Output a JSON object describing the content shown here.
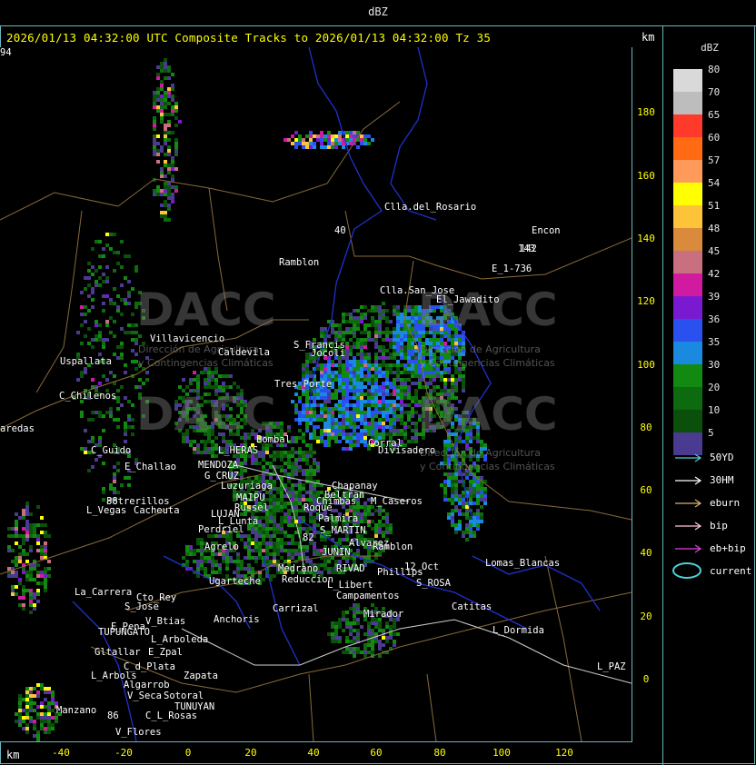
{
  "header": {
    "unit_label": "dBZ"
  },
  "title": "2026/01/13 04:32:00 UTC Composite Tracks to 2026/01/13 04:32:00 Tz 35",
  "km_top": "km",
  "km_bottom": "km",
  "legend": {
    "title": "dBZ",
    "scale": [
      {
        "value": "80",
        "color": "#d9d9d9"
      },
      {
        "value": "70",
        "color": "#bdbdbd"
      },
      {
        "value": "65",
        "color": "#ff3a2a"
      },
      {
        "value": "60",
        "color": "#ff6a12"
      },
      {
        "value": "57",
        "color": "#ff9a5a"
      },
      {
        "value": "54",
        "color": "#ffff00"
      },
      {
        "value": "51",
        "color": "#fdc43a"
      },
      {
        "value": "48",
        "color": "#d98a3a"
      },
      {
        "value": "45",
        "color": "#c87080"
      },
      {
        "value": "42",
        "color": "#d01aa0"
      },
      {
        "value": "39",
        "color": "#7a1ad0"
      },
      {
        "value": "36",
        "color": "#2a50f0"
      },
      {
        "value": "35",
        "color": "#1a8ae0"
      },
      {
        "value": "30",
        "color": "#128a12"
      },
      {
        "value": "20",
        "color": "#0e6a0e"
      },
      {
        "value": "10",
        "color": "#0a500a"
      },
      {
        "value": "5",
        "color": "#4a3a90"
      }
    ],
    "tracks": [
      {
        "label": "50YD",
        "color": "#4fd0d8"
      },
      {
        "label": "30HM",
        "color": "#ffffff"
      },
      {
        "label": "eburn",
        "color": "#e0b070"
      },
      {
        "label": "bip",
        "color": "#ffc8d8"
      },
      {
        "label": "eb+bip",
        "color": "#e040e0"
      }
    ],
    "current_label": "current",
    "current_color": "#4fd0d8"
  },
  "axes": {
    "y_ticks": [
      "180",
      "160",
      "140",
      "120",
      "100",
      "80",
      "60",
      "40",
      "20",
      "0"
    ],
    "x_ticks": [
      "-40",
      "-20",
      "0",
      "20",
      "40",
      "60",
      "80",
      "100",
      "120"
    ]
  },
  "places": [
    {
      "name": "Clla.del_Rosario"
    },
    {
      "name": "Encon"
    },
    {
      "name": "142"
    },
    {
      "name": "E_1-736"
    },
    {
      "name": "Ramblon"
    },
    {
      "name": "Clla.San_Jose"
    },
    {
      "name": "El_Jawadito"
    },
    {
      "name": "Villavicencio"
    },
    {
      "name": "Uspallata"
    },
    {
      "name": "Caldevila"
    },
    {
      "name": "S_Francis"
    },
    {
      "name": "Jocoli"
    },
    {
      "name": "Tres_Porte"
    },
    {
      "name": "C_Chilenos"
    },
    {
      "name": "aredas"
    },
    {
      "name": "Bombal"
    },
    {
      "name": "L_HERAS"
    },
    {
      "name": "Corral"
    },
    {
      "name": "Divisadero"
    },
    {
      "name": "C_Guido"
    },
    {
      "name": "E_Challao"
    },
    {
      "name": "MENDOZA"
    },
    {
      "name": "G_CRUZ"
    },
    {
      "name": "Luzuriaga"
    },
    {
      "name": "Chapanay"
    },
    {
      "name": "Beltran"
    },
    {
      "name": "Chimbas"
    },
    {
      "name": "M_Caseros"
    },
    {
      "name": "Potrerillos"
    },
    {
      "name": "L_Vegas"
    },
    {
      "name": "Cacheuta"
    },
    {
      "name": "MAIPU"
    },
    {
      "name": "Russel"
    },
    {
      "name": "LUJAN"
    },
    {
      "name": "L_Lunta"
    },
    {
      "name": "Roque"
    },
    {
      "name": "Palmira"
    },
    {
      "name": "Perdriel"
    },
    {
      "name": "S_MARTIN"
    },
    {
      "name": "Alvarez"
    },
    {
      "name": "Ramblon"
    },
    {
      "name": "Agrelo"
    },
    {
      "name": "JUNIN"
    },
    {
      "name": "12_Oct"
    },
    {
      "name": "Lomas_Blancas"
    },
    {
      "name": "Medrano"
    },
    {
      "name": "RIVAD"
    },
    {
      "name": "Phillips"
    },
    {
      "name": "Reduccion"
    },
    {
      "name": "L_Libert"
    },
    {
      "name": "S_ROSA"
    },
    {
      "name": "Ugarteche"
    },
    {
      "name": "La_Carrera"
    },
    {
      "name": "Cto_Rey"
    },
    {
      "name": "S_Jose"
    },
    {
      "name": "Campamentos"
    },
    {
      "name": "Catitas"
    },
    {
      "name": "Carrizal"
    },
    {
      "name": "Mirador"
    },
    {
      "name": "V_Btias"
    },
    {
      "name": "Anchoris"
    },
    {
      "name": "E_Pena"
    },
    {
      "name": "TUPUNGATO"
    },
    {
      "name": "L_Dormida"
    },
    {
      "name": "L_Arboleda"
    },
    {
      "name": "Gltallar"
    },
    {
      "name": "E_Zpal"
    },
    {
      "name": "C_d_Plata"
    },
    {
      "name": "L_Arbols"
    },
    {
      "name": "Zapata"
    },
    {
      "name": "L_PAZ"
    },
    {
      "name": "Algarrob"
    },
    {
      "name": "V_Seca"
    },
    {
      "name": "Sotoral"
    },
    {
      "name": "TUNUYAN"
    },
    {
      "name": "Manzano"
    },
    {
      "name": "C_L_Rosas"
    },
    {
      "name": "V_Flores"
    },
    {
      "name": "40"
    },
    {
      "name": "143"
    },
    {
      "name": "88"
    },
    {
      "name": "82"
    },
    {
      "name": "86"
    },
    {
      "name": "94"
    }
  ],
  "watermark": {
    "brand": "DACC",
    "subtitle1": "Dirección de Agricultura",
    "subtitle2": "y Contingencias Climáticas"
  }
}
